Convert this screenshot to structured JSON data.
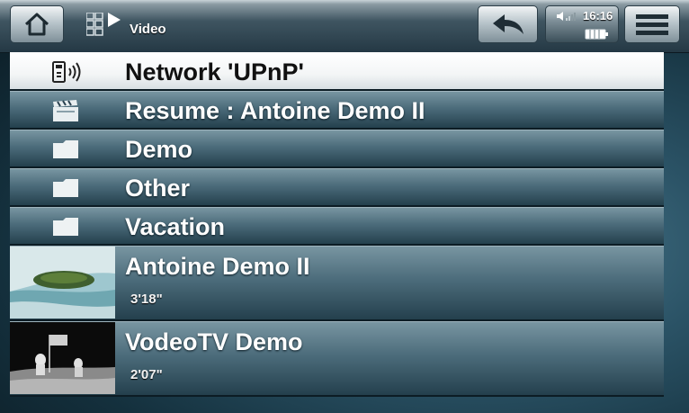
{
  "topbar": {
    "breadcrumb": "Video",
    "clock": "16:16"
  },
  "list": {
    "items": [
      {
        "label": "Network 'UPnP'",
        "icon": "network-device-icon",
        "selected": true
      },
      {
        "label": "Resume : Antoine Demo II",
        "icon": "clapperboard-icon"
      },
      {
        "label": "Demo",
        "icon": "folder-icon"
      },
      {
        "label": "Other",
        "icon": "folder-icon"
      },
      {
        "label": "Vacation",
        "icon": "folder-icon"
      }
    ],
    "videos": [
      {
        "title": "Antoine Demo II",
        "duration": "3'18\"",
        "thumbnail": "island-thumbnail"
      },
      {
        "title": "VodeoTV Demo",
        "duration": "2'07\"",
        "thumbnail": "moon-landing-thumbnail"
      }
    ]
  },
  "colors": {
    "selected_row": "#ffffff",
    "row_gradient_top": "#7895a1",
    "row_gradient_bottom": "#24404d",
    "background": "#2b5366"
  }
}
